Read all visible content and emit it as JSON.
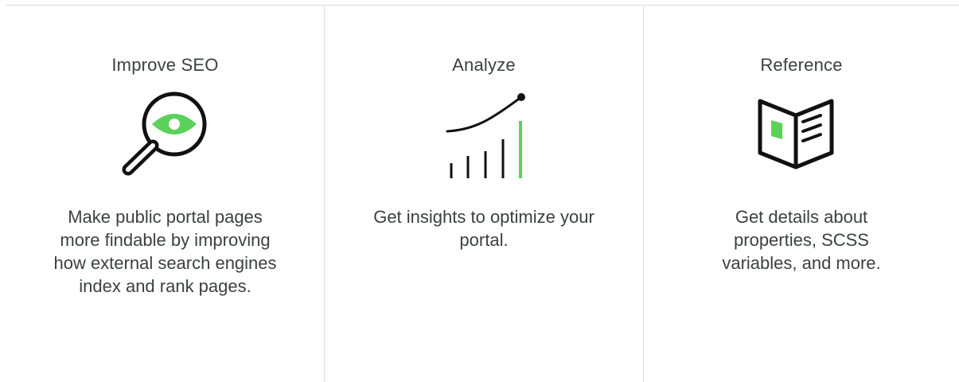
{
  "colors": {
    "accent": "#5bd15b",
    "ink": "#111111",
    "text": "#3c4043",
    "divider": "#dadce0"
  },
  "cards": [
    {
      "title": "Improve SEO",
      "icon": "magnifier-eye-icon",
      "description": "Make public portal pages more findable by improving how external search engines index and rank pages."
    },
    {
      "title": "Analyze",
      "icon": "growth-chart-icon",
      "description": "Get insights to optimize your portal."
    },
    {
      "title": "Reference",
      "icon": "open-book-icon",
      "description": "Get details about properties, SCSS variables, and more."
    }
  ]
}
